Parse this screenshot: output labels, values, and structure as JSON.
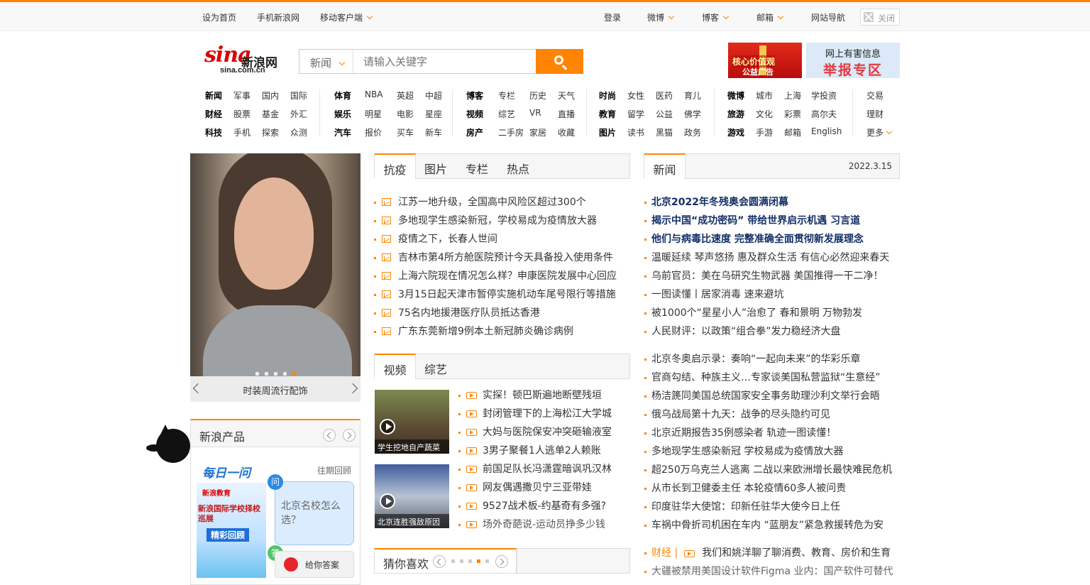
{
  "topbar": {
    "set_home": "设为首页",
    "mobile_sina": "手机新浪网",
    "mobile_client": "移动客户端",
    "login": "登录",
    "weibo": "微博",
    "blog": "博客",
    "mail": "邮箱",
    "site_nav": "网站导航",
    "close": "关闭"
  },
  "logo": {
    "main": "sina",
    "cn": "新浪网",
    "domain": "sina.com.cn"
  },
  "search": {
    "category": "新闻",
    "placeholder": "请输入关键字"
  },
  "ads": {
    "ad1_line1": "核心价值观",
    "ad1_line2": "公益广告",
    "ad2_line1": "网上有害信息",
    "ad2_line2": "举报专区"
  },
  "nav": {
    "g1": [
      [
        "新闻",
        "军事",
        "国内",
        "国际"
      ],
      [
        "财经",
        "股票",
        "基金",
        "外汇"
      ],
      [
        "科技",
        "手机",
        "探索",
        "众测"
      ]
    ],
    "g2": [
      [
        "体育",
        "NBA",
        "英超",
        "中超"
      ],
      [
        "娱乐",
        "明星",
        "电影",
        "星座"
      ],
      [
        "汽车",
        "报价",
        "买车",
        "新车"
      ]
    ],
    "g3": [
      [
        "博客",
        "专栏",
        "历史",
        "天气"
      ],
      [
        "视频",
        "综艺",
        "VR",
        "直播"
      ],
      [
        "房产",
        "二手房",
        "家居",
        "收藏"
      ]
    ],
    "g4": [
      [
        "时尚",
        "女性",
        "医药",
        "育儿"
      ],
      [
        "教育",
        "留学",
        "公益",
        "佛学"
      ],
      [
        "图片",
        "读书",
        "黑猫",
        "政务"
      ]
    ],
    "g5": [
      [
        "微博",
        "城市",
        "上海",
        "学投资"
      ],
      [
        "旅游",
        "文化",
        "彩票",
        "高尔夫"
      ],
      [
        "游戏",
        "手游",
        "邮箱",
        "English"
      ]
    ],
    "g6": [
      "交易",
      "理财",
      "更多"
    ]
  },
  "slider": {
    "caption": "时装周流行配饰"
  },
  "products": {
    "title": "新浪产品",
    "daily": "每日一问",
    "past": "往期回顾",
    "banner_brand": "新浪教育",
    "banner_title": "新浪国际学校择校巡展",
    "banner_sub": "精彩回顾",
    "q_badge": "问",
    "question": "北京名校怎么选？",
    "a_badge": "答",
    "answer_btn": "给你答案"
  },
  "tabs1": [
    "抗疫",
    "图片",
    "专栏",
    "热点"
  ],
  "list1": [
    "江苏一地升级，全国高中风险区超过300个",
    "多地现学生感染新冠，学校易成为疫情放大器",
    "疫情之下，长春人世间",
    "吉林市第4所方舱医院预计今天具备投入使用条件",
    "上海六院现在情况怎么样？申康医院发展中心回应",
    "3月15日起天津市暂停实施机动车尾号限行等措施",
    "75名内地援港医疗队员抵达香港",
    "广东东莞新增9例本土新冠肺炎确诊病例"
  ],
  "tabs2": [
    "视频",
    "综艺"
  ],
  "thumbs": [
    "学生挖地自产蔬菜",
    "北京连胜强敌原因"
  ],
  "list2": [
    "实探！顿巴斯遍地断壁残垣",
    "封闭管理下的上海松江大学城",
    "大妈与医院保安冲突砸输液室",
    "3男子聚餐1人逃单2人赖账",
    "前国足队长冯潇霆暗讽巩汉林",
    "网友偶遇撒贝宁三亚带娃",
    "9527战术板-约基奇有多强?",
    "场外奇葩说-运动员挣多少钱"
  ],
  "guess": {
    "title": "猜你喜欢"
  },
  "news": {
    "tab": "新闻",
    "date": "2022.3.15"
  },
  "news_bold": [
    "北京2022年冬残奥会圆满闭幕",
    "揭示中国“成功密码” 带给世界启示机遇 习言道",
    "他们与病毒比速度 完整准确全面贯彻新发展理念"
  ],
  "news_a": [
    "温暖延续 琴声悠扬 惠及群众生活 有信心必然迎来春天",
    "乌前官员：美在乌研究生物武器 美国推得一干二净！",
    "一图读懂丨居家消毒 速来避坑",
    "被1000个“星星小人”治愈了 春和景明 万物勃发",
    "人民财评：以政策“组合拳”发力稳经济大盘"
  ],
  "news_b": [
    "北京冬奥启示录：奏响“一起向未来”的华彩乐章",
    "官商勾结、种族主义…专家谈美国私营监狱“生意经”",
    "杨洁篪同美国总统国家安全事务助理沙利文举行会晤",
    "俄乌战局第十九天：战争的尽头隐约可见",
    "北京近期报告35例感染者 轨迹一图读懂！",
    "多地现学生感染新冠 学校易成为疫情放大器",
    "超250万乌克兰人逃离 二战以来欧洲增长最快难民危机",
    "从市长到卫健委主任 本轮疫情60多人被问责",
    "印度驻华大使馆：印新任驻华大使今日上任",
    "车祸中骨折司机困在车内 “蓝朋友”紧急救援转危为安"
  ],
  "finance": {
    "label": "财经 |",
    "text": "我们和姚洋聊了聊消费、教育、房价和生育"
  },
  "last_news": "大疆被禁用美国设计软件Figma 业内：国产软件可替代",
  "colors": {
    "accent": "#ff8400",
    "dark_blue": "#122e67",
    "link": "#333333"
  }
}
